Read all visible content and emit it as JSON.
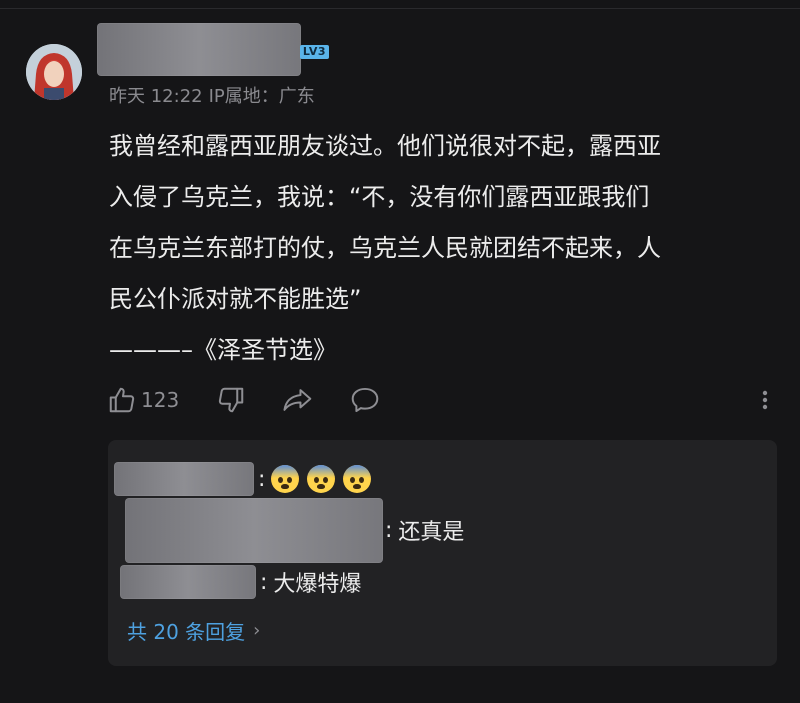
{
  "post": {
    "level_badge": "LV3",
    "meta": {
      "time": "昨天 12:22",
      "ip_label": "IP属地：",
      "location": "广东"
    },
    "content_lines": [
      "我曾经和露西亚朋友谈过。他们说很对不起，露西亚",
      "入侵了乌克兰，我说：“不，没有你们露西亚跟我们",
      "在乌克兰东部打的仗，乌克兰人民就团结不起来，人",
      "民公仆派对就不能胜选”",
      "———–《泽圣节选》"
    ]
  },
  "actions": {
    "like_count": "123",
    "icons": [
      "thumbs-up-icon",
      "thumbs-down-icon",
      "share-icon",
      "comment-icon",
      "more-vertical-icon"
    ]
  },
  "replies": {
    "items": [
      {
        "colon": ":",
        "text": "",
        "emoji_count": 3
      },
      {
        "colon": ":",
        "text": "还真是"
      },
      {
        "colon": ":",
        "text": "大爆特爆"
      }
    ],
    "more_label": "共 20 条回复",
    "more_chevron": "›"
  },
  "colors": {
    "background": "#151517",
    "panel": "#222224",
    "link": "#4ea1e0",
    "badge": "#5ab4ea"
  }
}
